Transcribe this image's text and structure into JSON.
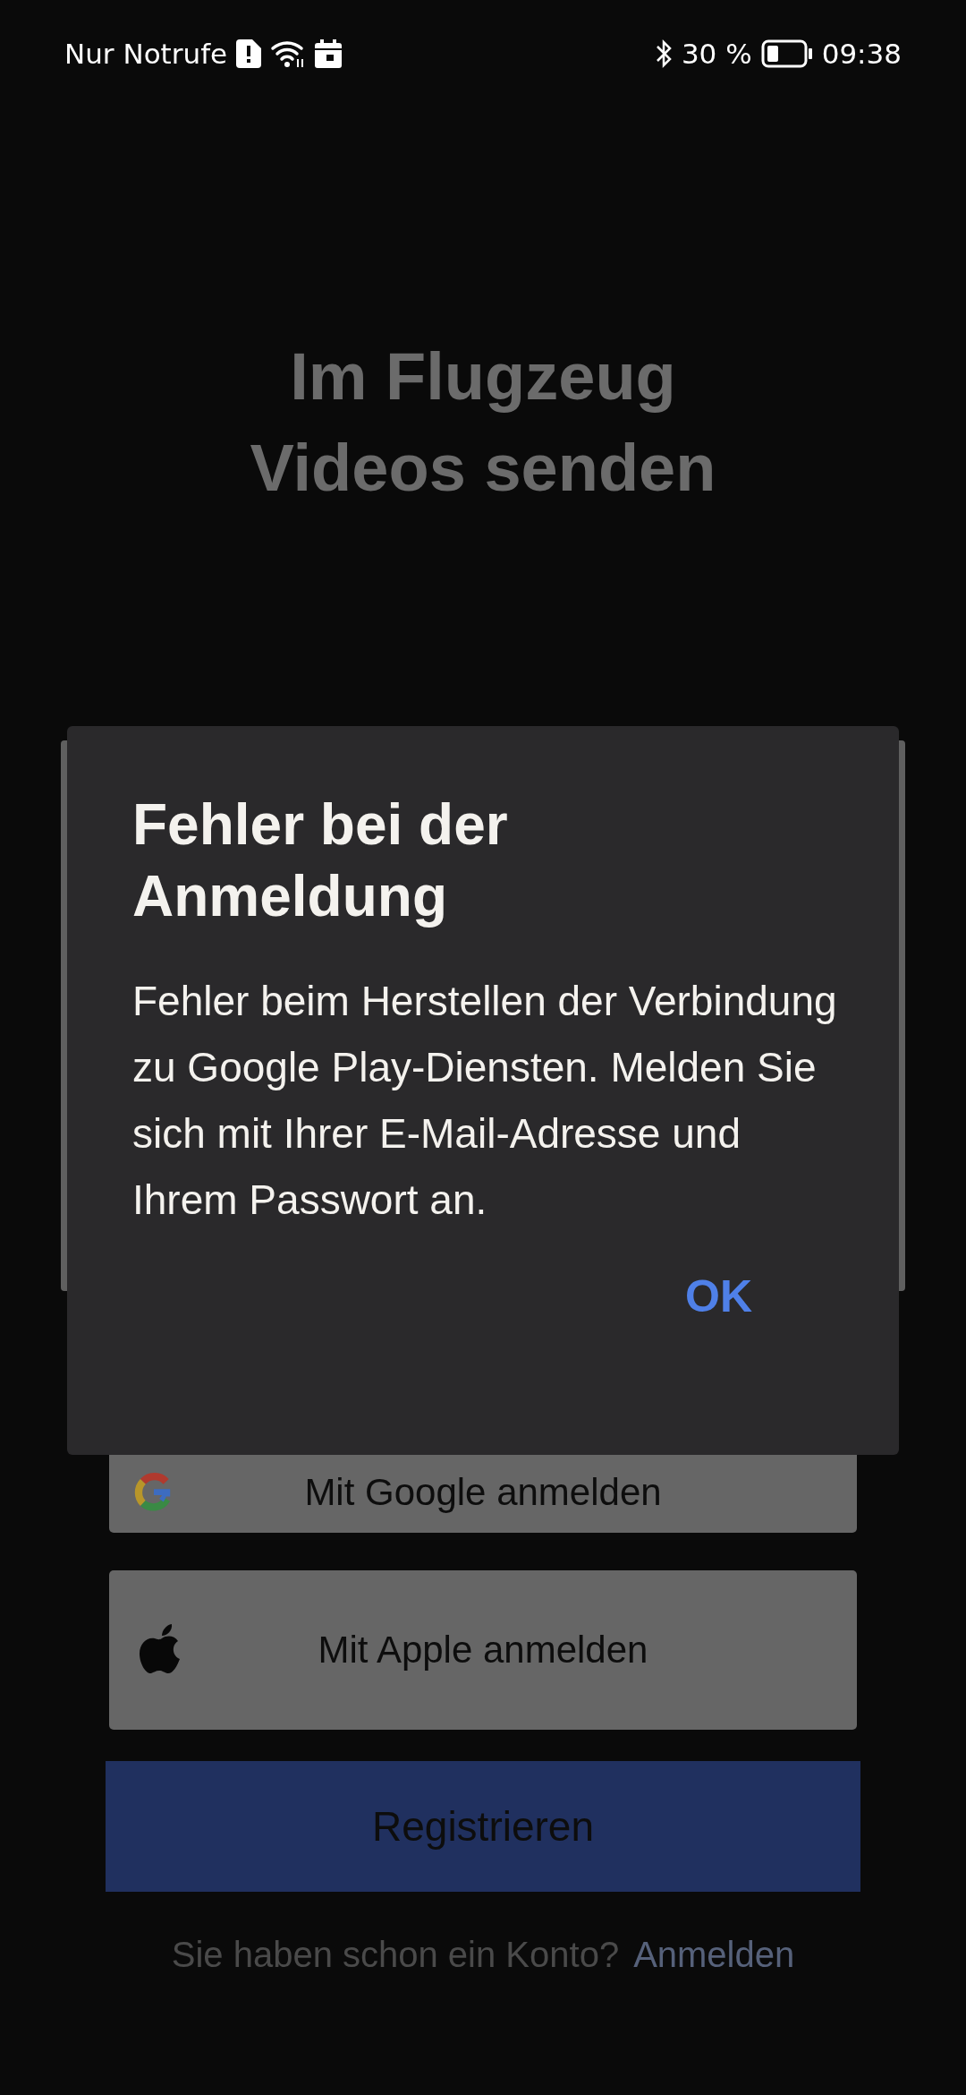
{
  "status_bar": {
    "carrier": "Nur Notrufe",
    "battery": "30 %",
    "time": "09:38"
  },
  "headline": "Im Flugzeug Videos senden",
  "buttons": [
    {
      "kind": "google",
      "label": "Mit Google anmelden"
    },
    {
      "kind": "apple",
      "label": "Mit Apple anmelden"
    },
    {
      "kind": "register",
      "label": "Registrieren"
    }
  ],
  "footer": {
    "text": "Sie haben schon ein Konto?",
    "link": "Anmelden"
  },
  "dialog": {
    "title": "Fehler bei der Anmeldung",
    "message": "Fehler beim Herstellen der Verbindung zu Google Play-Diensten. Melden Sie sich mit Ihrer E-Mail-Adresse und Ihrem Passwort an.",
    "button": "OK"
  }
}
